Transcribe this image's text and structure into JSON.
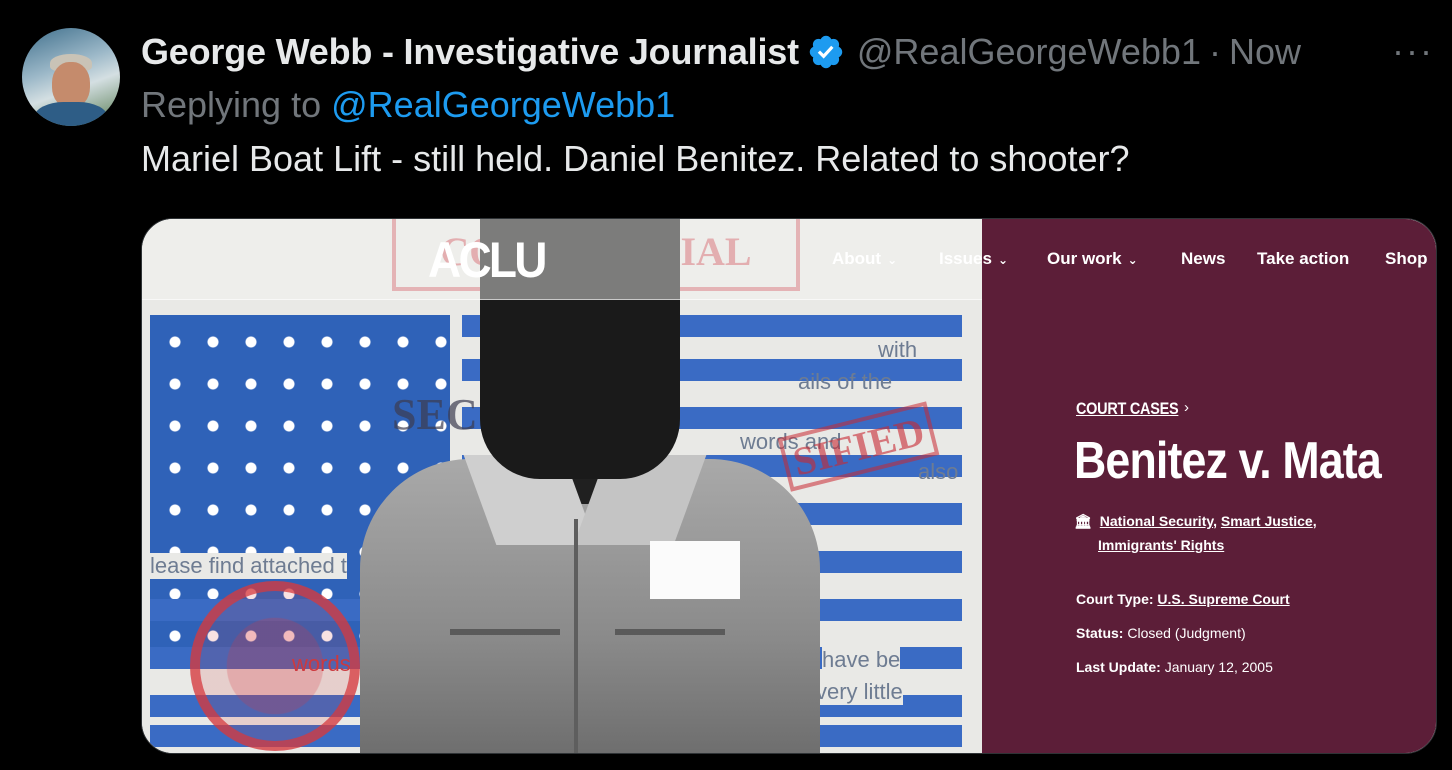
{
  "tweet": {
    "author_name": "George Webb - Investigative Journalist",
    "handle": "@RealGeorgeWebb1",
    "separator": "·",
    "time": "Now",
    "more": "···",
    "replying_prefix": "Replying to",
    "replying_to": "@RealGeorgeWebb1",
    "text": "Mariel Boat Lift - still held.  Daniel Benitez. Related to shooter?"
  },
  "aclu": {
    "logo": "ACLU",
    "nav": [
      {
        "label": "About",
        "dropdown": true
      },
      {
        "label": "Issues",
        "dropdown": true
      },
      {
        "label": "Our work",
        "dropdown": true
      },
      {
        "label": "News",
        "dropdown": false
      },
      {
        "label": "Take action",
        "dropdown": false
      },
      {
        "label": "Shop",
        "dropdown": false
      }
    ],
    "breadcrumb": "COURT CASES",
    "breadcrumb_arrow": "›",
    "case_title": "Benitez v. Mata",
    "issues": [
      "National Security",
      "Smart Justice",
      "Immigrants' Rights"
    ],
    "court_type_label": "Court Type:",
    "court_type": "U.S. Supreme Court",
    "status_label": "Status:",
    "status": "Closed (Judgment)",
    "last_update_label": "Last Update:",
    "last_update": "January 12, 2005"
  },
  "art_text": {
    "with": "with",
    "ails": "ails of the",
    "words": "words and",
    "also": "also",
    "please": "lease find attached t",
    "have": "have be",
    "little": "very little",
    "words2": "words",
    "sec": "SEC",
    "classified": "SIFIED",
    "confidential": "CONFIDENTIAL"
  },
  "colors": {
    "accent": "#1d9bf0",
    "muted": "#71767b",
    "aclu_maroon": "#5c1e38"
  }
}
